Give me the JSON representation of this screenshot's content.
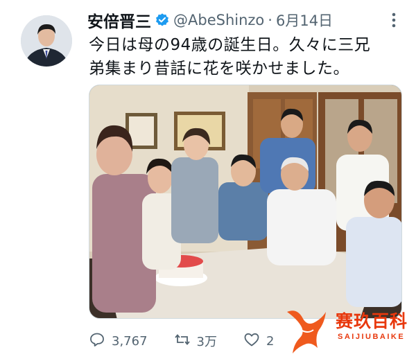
{
  "tweet": {
    "author": {
      "display_name": "安倍晋三",
      "handle": "@AbeShinzo",
      "verified": true
    },
    "separator": "·",
    "timestamp": "6月14日",
    "text_line1": "今日は母の94歳の誕生日。久々に三兄",
    "text_line2": "弟集まり昔話に花を咲かせました。",
    "media": {
      "type": "photo"
    },
    "actions": {
      "reply_count": "3,767",
      "retweet_count": "3万",
      "like_count": "2"
    }
  },
  "watermark": {
    "brand_cn": "赛玖百科",
    "brand_en": "SAIJIUBAIKE"
  },
  "colors": {
    "text_primary": "#0f1419",
    "text_secondary": "#536471",
    "verified_blue": "#1d9bf0",
    "watermark_orange": "#e8380d"
  },
  "icons": [
    "verified-badge-icon",
    "more-icon",
    "reply-icon",
    "retweet-icon",
    "like-icon",
    "watermark-logo-icon"
  ]
}
